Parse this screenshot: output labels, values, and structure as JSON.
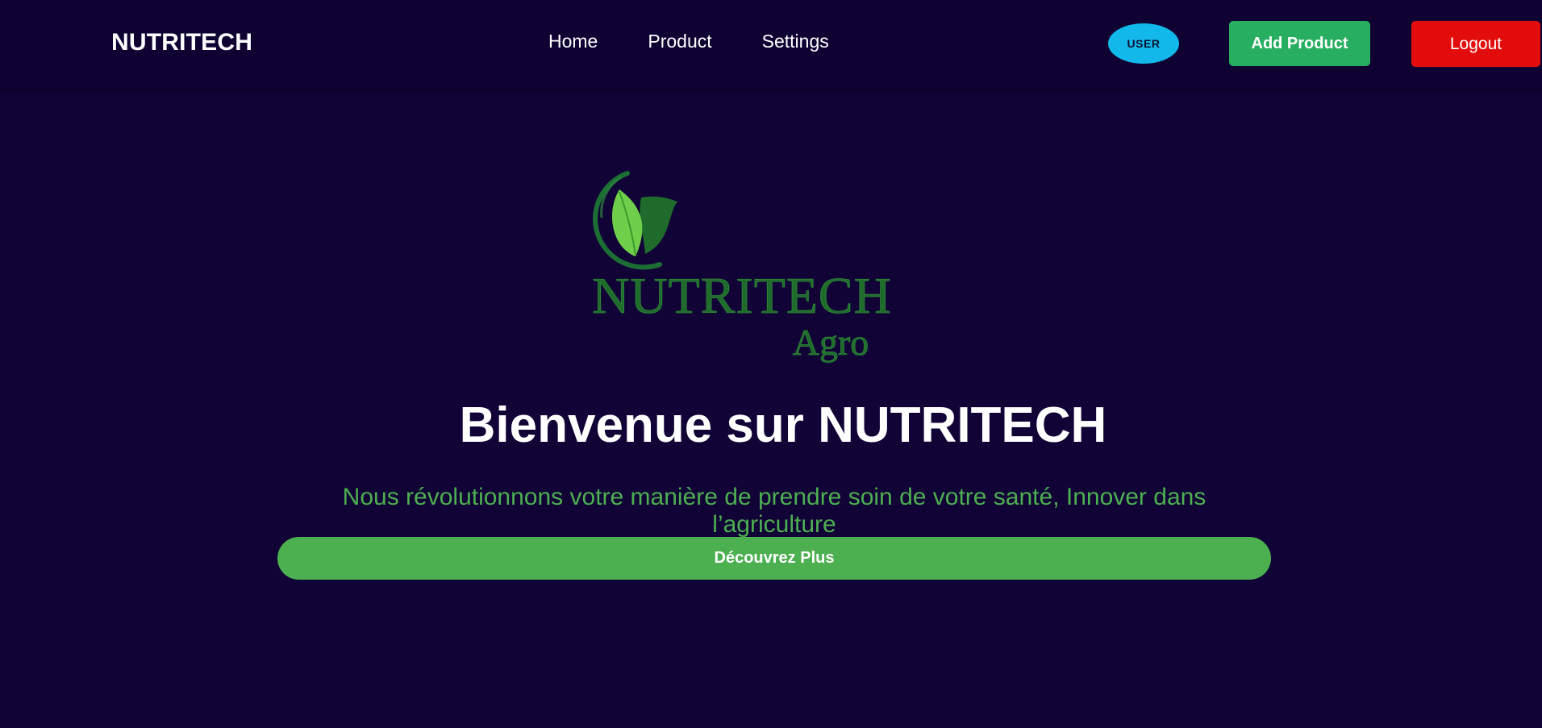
{
  "header": {
    "brand": "NUTRITECH",
    "nav": [
      {
        "label": "Home"
      },
      {
        "label": "Product"
      },
      {
        "label": "Settings"
      }
    ],
    "user_badge": "USER",
    "add_product_label": "Add Product",
    "logout_label": "Logout"
  },
  "logo": {
    "main_text": "NUTRITECH",
    "sub_text": "Agro",
    "icon": "leaf-icon"
  },
  "hero": {
    "title": "Bienvenue sur NUTRITECH",
    "subtitle": "Nous révolutionnons votre manière de prendre soin de votre santé, Innover dans l’agriculture",
    "cta_label": "Découvrez Plus"
  },
  "colors": {
    "background": "#110335",
    "navbar": "#0f0233",
    "accent_green": "#4caf50",
    "add_button": "#27ae60",
    "logout_button": "#e20c0c",
    "user_badge": "#12b8ea"
  }
}
